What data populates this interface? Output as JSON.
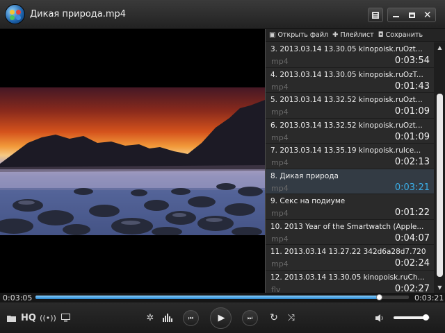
{
  "window": {
    "title": "Дикая природа.mp4",
    "icons": {
      "logo": "app-logo",
      "playlist_toggle": "playlist-icon",
      "minimize": "minimize-icon",
      "maximize": "maximize-icon",
      "close": "close-icon"
    }
  },
  "playlist": {
    "toolbar": {
      "open_file": "Открыть файл",
      "playlist": "Плейлист",
      "save": "Сохранить"
    },
    "items": [
      {
        "title": "3.  2013.03.14 13.30.05 kinopoisk.ruOzt...",
        "ext": "mp4",
        "duration": "0:03:54",
        "active": false
      },
      {
        "title": "4.  2013.03.14 13.30.05 kinopoisk.ruOzT...",
        "ext": "mp4",
        "duration": "0:01:43",
        "active": false
      },
      {
        "title": "5.  2013.03.14 13.32.52 kinopoisk.ruOzt...",
        "ext": "mp4",
        "duration": "0:01:09",
        "active": false
      },
      {
        "title": "6.  2013.03.14 13.32.52 kinopoisk.ruOzt...",
        "ext": "mp4",
        "duration": "0:01:09",
        "active": false
      },
      {
        "title": "7.  2013.03.14 13.35.19 kinopoisk.ruIce...",
        "ext": "mp4",
        "duration": "0:02:13",
        "active": false
      },
      {
        "title": "8.  Дикая природа",
        "ext": "mp4",
        "duration": "0:03:21",
        "active": true
      },
      {
        "title": "9.  Секс на подиуме",
        "ext": "mp4",
        "duration": "0:01:22",
        "active": false
      },
      {
        "title": "10.  2013 Year of the Smartwatch (Apple...",
        "ext": "mp4",
        "duration": "0:04:07",
        "active": false
      },
      {
        "title": "11.  2013.03.14 13.27.22 342d6a28d7.720",
        "ext": "mp4",
        "duration": "0:02:24",
        "active": false
      },
      {
        "title": "12.  2013.03.14 13.30.05 kinopoisk.ruCh...",
        "ext": "flv",
        "duration": "0:02:27",
        "active": false
      }
    ]
  },
  "seek": {
    "elapsed": "0:03:05",
    "total": "0:03:21",
    "progress": 0.92
  },
  "controls": {
    "hq_label": "HQ",
    "volume": 0.88,
    "colors": {
      "accent": "#3aaee8"
    }
  }
}
